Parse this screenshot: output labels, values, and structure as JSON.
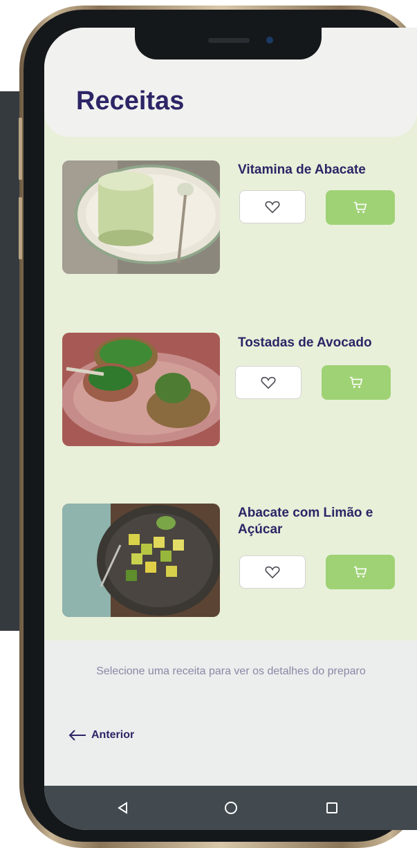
{
  "header": {
    "title": "Receitas"
  },
  "recipes": [
    {
      "title": "Vitamina de Abacate",
      "favorite_icon": "heart-outline",
      "cart_icon": "cart"
    },
    {
      "title": "Tostadas de Avocado",
      "favorite_icon": "heart-outline",
      "cart_icon": "cart"
    },
    {
      "title": "Abacate com Limão e Açúcar",
      "favorite_icon": "heart-outline",
      "cart_icon": "cart"
    }
  ],
  "footer": {
    "hint": "Selecione uma receita para ver os detalhes do preparo",
    "prev_label": "Anterior"
  },
  "navbar": {
    "icons": [
      "back-triangle",
      "home-circle",
      "recents-square"
    ]
  },
  "colors": {
    "title": "#2c2566",
    "cart": "#9fd275",
    "list_bg": "#e8f0d9",
    "navbar": "#424a4f"
  }
}
